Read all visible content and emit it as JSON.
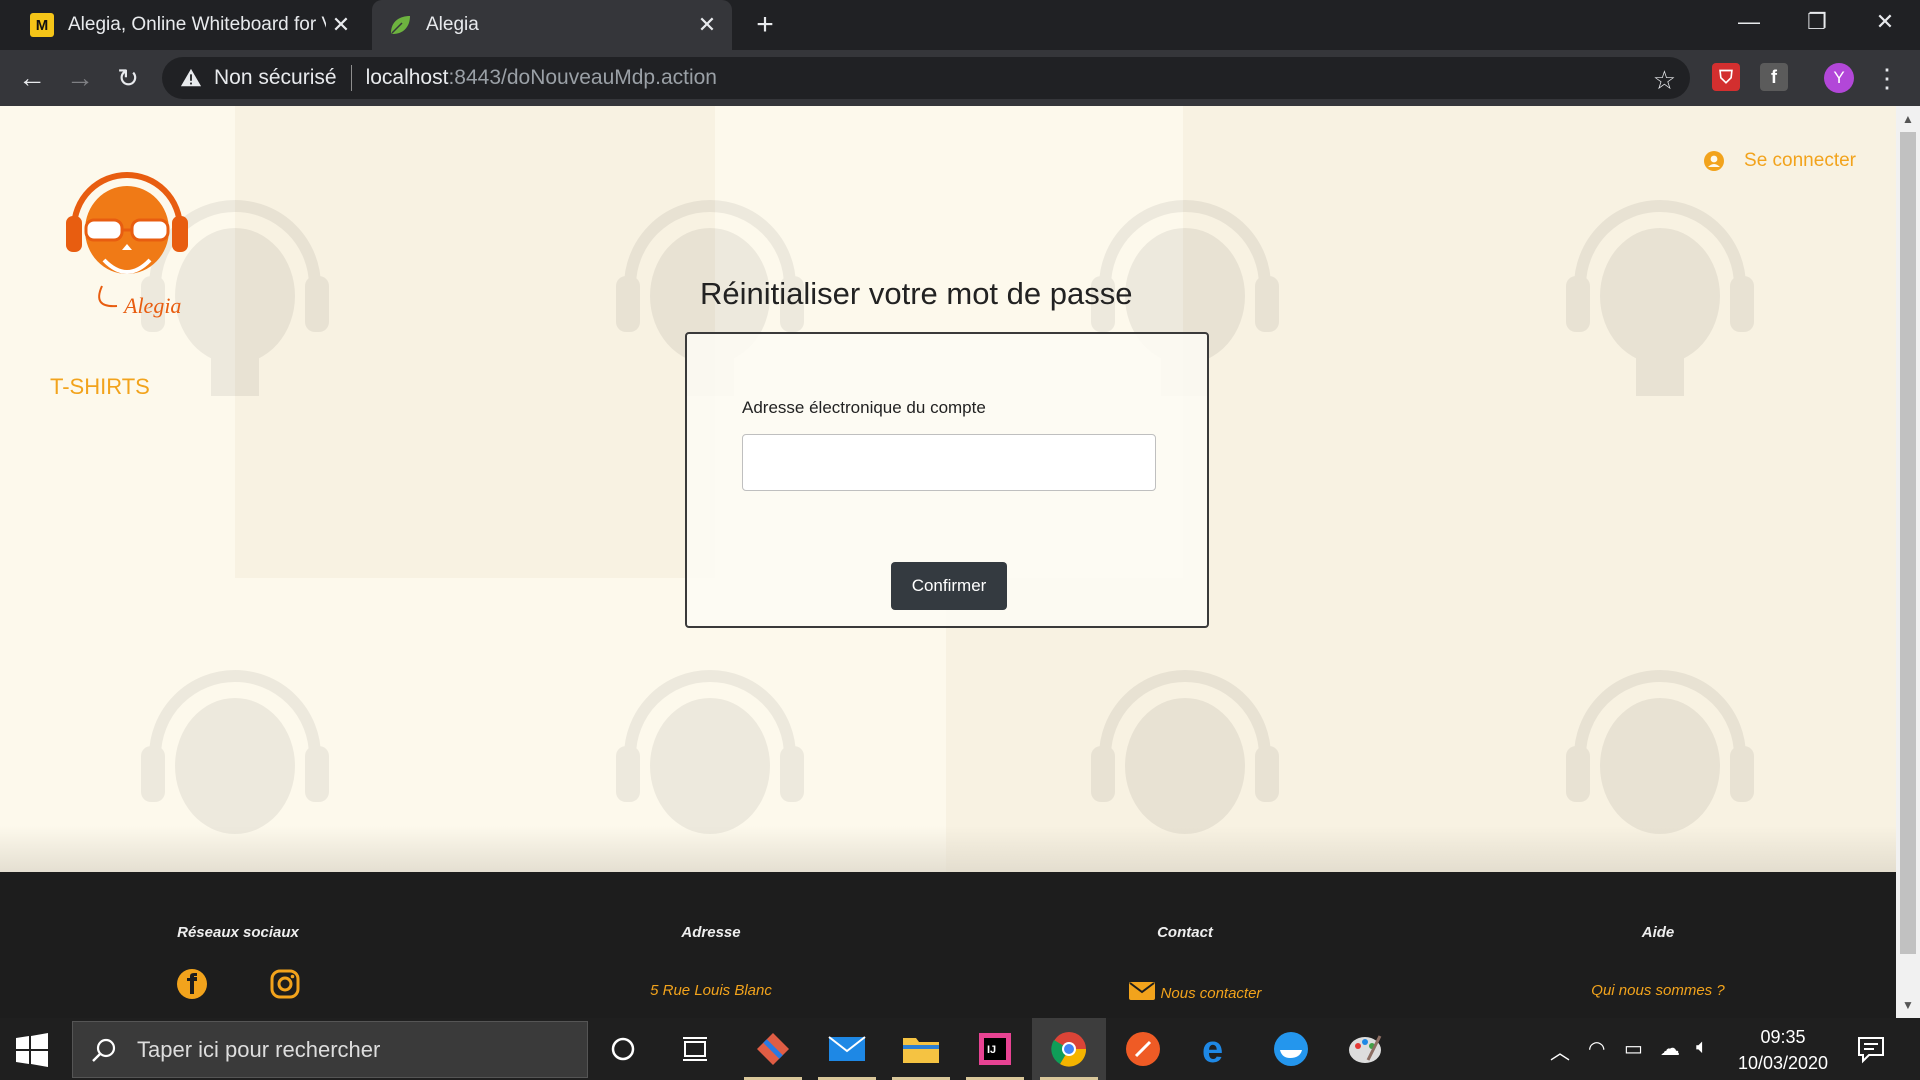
{
  "browser": {
    "tabs": [
      {
        "title": "Alegia, Online Whiteboard for Vi",
        "favicon": "miro-icon",
        "active": false
      },
      {
        "title": "Alegia",
        "favicon": "leaf-icon",
        "active": true
      }
    ],
    "security_label": "Non sécurisé",
    "url_host": "localhost",
    "url_path": ":8443/doNouveauMdp.action",
    "profile_initial": "Y"
  },
  "page": {
    "nav": {
      "tshirts": "T-SHIRTS",
      "login": "Se connecter"
    },
    "title": "Réinitialiser votre mot de passe",
    "form": {
      "email_label": "Adresse électronique du compte",
      "email_value": "",
      "confirm_label": "Confirmer"
    },
    "footer": {
      "social_heading": "Réseaux sociaux",
      "address_heading": "Adresse",
      "address": "5 Rue Louis Blanc",
      "contact_heading": "Contact",
      "contact_link": "Nous contacter",
      "help_heading": "Aide",
      "help_link": "Qui nous sommes ?"
    },
    "colors": {
      "accent": "#f2a31c",
      "background": "#fdf9ec",
      "footer": "#1d1d1d",
      "button": "#343a40"
    }
  },
  "taskbar": {
    "search_placeholder": "Taper ici pour rechercher",
    "time": "09:35",
    "date": "10/03/2020"
  }
}
